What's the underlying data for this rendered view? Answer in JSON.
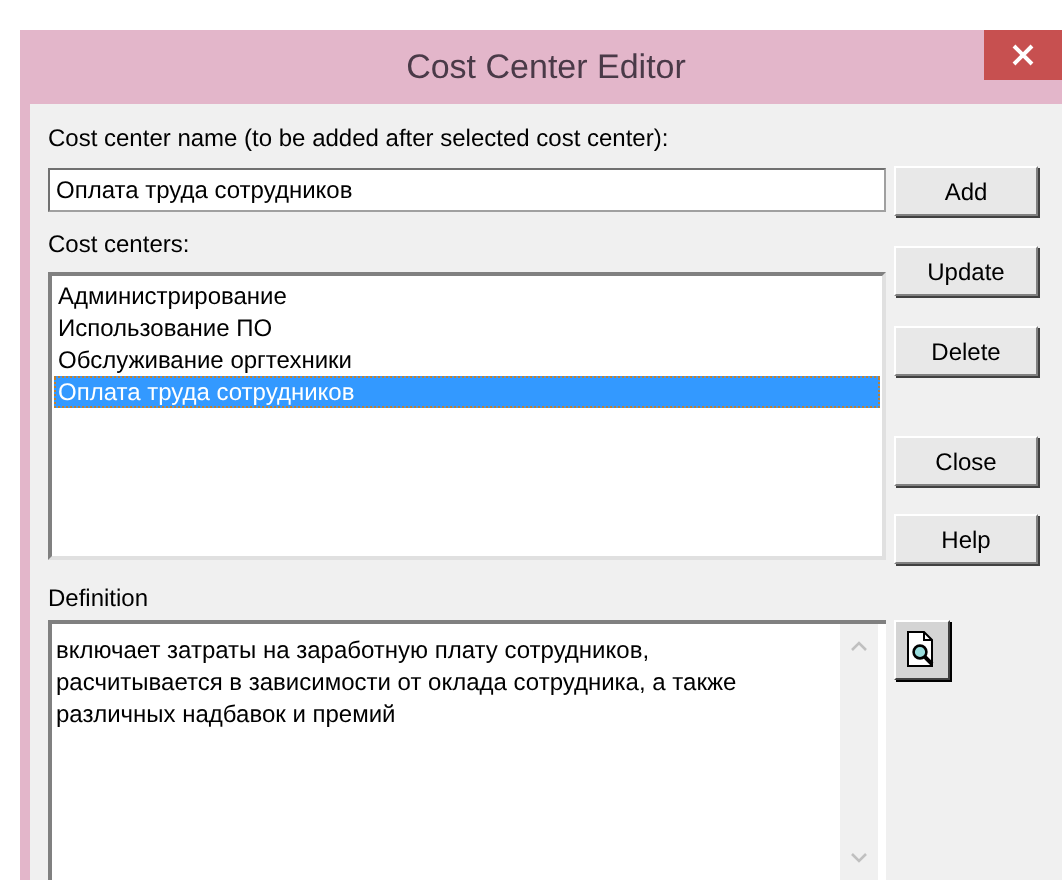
{
  "window": {
    "title": "Cost Center Editor"
  },
  "name_field": {
    "label": "Cost center name (to be added after selected cost center):",
    "value": "Оплата труда сотрудников"
  },
  "cost_centers": {
    "label": "Cost centers:",
    "items": [
      {
        "label": "Администрирование",
        "selected": false
      },
      {
        "label": "Использование ПО",
        "selected": false
      },
      {
        "label": "Обслуживание оргтехники",
        "selected": false
      },
      {
        "label": "Оплата труда сотрудников",
        "selected": true
      }
    ]
  },
  "definition": {
    "label": "Definition",
    "value": "включает затраты на заработную плату сотрудников, расчитывается в зависимости от оклада сотрудника, а также различных надбавок и премий"
  },
  "buttons": [
    {
      "label": "Add",
      "kind": "add"
    },
    {
      "label": "Update",
      "kind": "update"
    },
    {
      "label": "Delete",
      "kind": "delete"
    },
    {
      "label": "Close",
      "kind": "close"
    },
    {
      "label": "Help",
      "kind": "help"
    }
  ]
}
